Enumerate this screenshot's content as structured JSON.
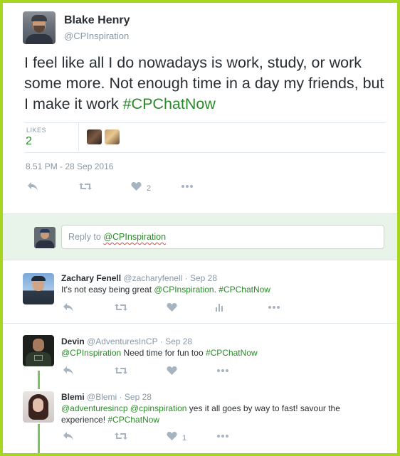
{
  "main_tweet": {
    "author_name": "Blake Henry",
    "author_handle": "@CPInspiration",
    "text": "I feel like all I do nowadays is work, study, or work some more.  Not enough time in a day my friends, but I make it work ",
    "hashtag": "#CPChatNow",
    "likes_label": "LIKES",
    "likes_count": "2",
    "timestamp": "8.51 PM - 28 Sep 2016",
    "like_action_count": "2"
  },
  "reply_box": {
    "prefix": "Reply to ",
    "mention": "@CPInspiration"
  },
  "replies": [
    {
      "name": "Zachary Fenell",
      "handle": "@zacharyfenell",
      "date": "Sep 28",
      "text_plain": "It's not easy being great ",
      "mention": "@CPInspiration",
      "text_plain2": ". ",
      "hashtag": "#CPChatNow",
      "like_count": ""
    },
    {
      "name": "Devin",
      "handle": "@AdventuresInCP",
      "date": "Sep 28",
      "mention": "@CPInspiration",
      "text_plain": " Need time for fun too ",
      "hashtag": "#CPChatNow",
      "like_count": ""
    },
    {
      "name": "Blemi",
      "handle": "@Blemi",
      "date": "Sep 28",
      "mention": "@adventuresincp @cpinspiration",
      "text_plain": " yes it all goes by way to fast! savour the experience! ",
      "hashtag": "#CPChatNow",
      "like_count": "1"
    }
  ],
  "separator": " · ",
  "colors": {
    "frame_border": "#a6d61f",
    "link_green": "#2a8a2a",
    "reply_band": "#e8f4ea",
    "thread_line": "#7fc25f"
  },
  "icons": [
    "reply-icon",
    "retweet-icon",
    "heart-icon",
    "more-icon",
    "analytics-icon"
  ]
}
